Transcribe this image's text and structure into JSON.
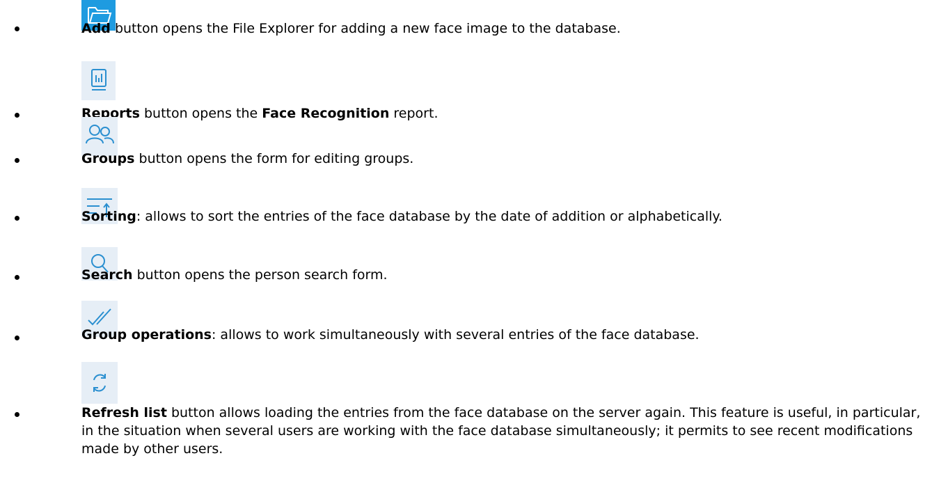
{
  "items": [
    {
      "icon": "open-folder-icon",
      "parts": [
        {
          "t": "Add",
          "b": true
        },
        {
          "t": " button opens the File Explorer for adding a new face image to the database.",
          "b": false
        }
      ]
    },
    {
      "icon": "report-icon",
      "parts": [
        {
          "t": "Reports",
          "b": true
        },
        {
          "t": " button opens the ",
          "b": false
        },
        {
          "t": "Face Recognition",
          "b": true
        },
        {
          "t": " report.",
          "b": false
        }
      ]
    },
    {
      "icon": "groups-icon",
      "parts": [
        {
          "t": "Groups",
          "b": true
        },
        {
          "t": " button opens the form for editing groups.",
          "b": false
        }
      ]
    },
    {
      "icon": "sort-icon",
      "parts": [
        {
          "t": "Sorting",
          "b": true
        },
        {
          "t": ": allows to sort the entries of the face database by the date of addition or alphabetically.",
          "b": false
        }
      ]
    },
    {
      "icon": "search-icon",
      "parts": [
        {
          "t": "Search",
          "b": true
        },
        {
          "t": " button opens the person search form.",
          "b": false
        }
      ]
    },
    {
      "icon": "double-check-icon",
      "parts": [
        {
          "t": "Group operations",
          "b": true
        },
        {
          "t": ": allows to work simultaneously with several entries of the face database.",
          "b": false
        }
      ]
    },
    {
      "icon": "refresh-icon",
      "parts": [
        {
          "t": "Refresh list",
          "b": true
        },
        {
          "t": " button allows loading the entries from the face database on the server again. This feature is useful, in particular, in the situation when several users are working with the face database simultaneously; it permits to see recent modifications made by other users.",
          "b": false
        }
      ]
    }
  ]
}
